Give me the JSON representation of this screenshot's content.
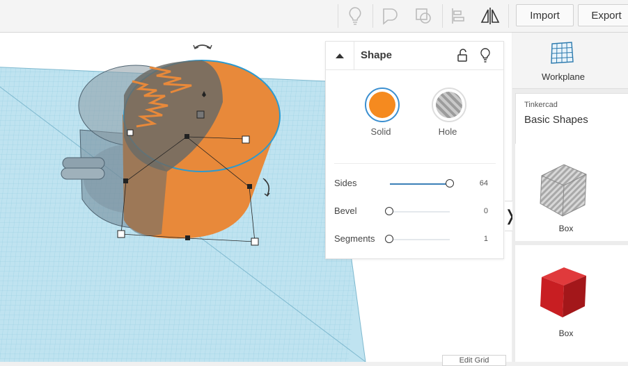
{
  "toolbar": {
    "icons": [
      "lightbulb-icon",
      "shape-icon",
      "shape-outline-icon",
      "align-icon",
      "mirror-icon"
    ],
    "import_label": "Import",
    "export_label": "Export"
  },
  "inspector": {
    "title": "Shape",
    "solid_label": "Solid",
    "hole_label": "Hole",
    "solid_color": "#f58a1f",
    "properties": [
      {
        "label": "Sides",
        "value": "64",
        "level": 1.0
      },
      {
        "label": "Bevel",
        "value": "0",
        "level": 0.0
      },
      {
        "label": "Segments",
        "value": "1",
        "level": 0.0
      }
    ]
  },
  "right_panel": {
    "workplane_label": "Workplane",
    "library_source": "Tinkercad",
    "library_name": "Basic Shapes",
    "shapes": [
      {
        "label": "Box",
        "style": "hole-striped"
      },
      {
        "label": "Box",
        "color": "#c81e22"
      }
    ]
  },
  "viewport": {
    "edit_grid_label": "Edit Grid",
    "grid_color": "#bfe3f0",
    "object_color": "#e8893a"
  }
}
